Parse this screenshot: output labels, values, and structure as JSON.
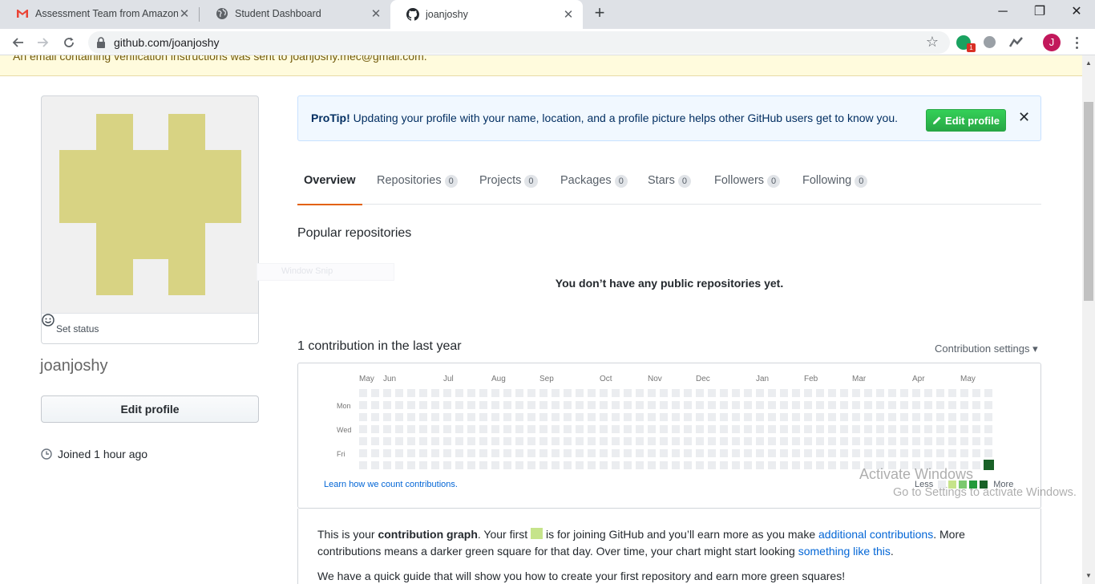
{
  "browser": {
    "tabs": [
      {
        "title": "Assessment Team from Amazon",
        "icon": "gmail-icon",
        "active": false
      },
      {
        "title": "Student Dashboard",
        "icon": "globe-icon",
        "active": false
      },
      {
        "title": "joanjoshy",
        "icon": "github-icon",
        "active": true
      }
    ],
    "tab_close": "✕",
    "new_tab": "+",
    "url": "github.com/joanjoshy",
    "extension_badge": "1",
    "profile_initial": "J",
    "window_controls": {
      "minimize": "─",
      "maximize": "❐",
      "close": "✕"
    }
  },
  "flash": {
    "message": "An email containing verification instructions was sent to joanjoshy.mec@gmail.com."
  },
  "sidebar": {
    "set_status": "Set status",
    "username": "joanjoshy",
    "edit_profile": "Edit profile",
    "joined": "Joined 1 hour ago"
  },
  "protip": {
    "label": "ProTip!",
    "text": " Updating your profile with your name, location, and a profile picture helps other GitHub users get to know you.",
    "button": "Edit profile",
    "close": "✕"
  },
  "nav_tabs": [
    {
      "label": "Overview",
      "count": null,
      "selected": true
    },
    {
      "label": "Repositories",
      "count": "0"
    },
    {
      "label": "Projects",
      "count": "0"
    },
    {
      "label": "Packages",
      "count": "0"
    },
    {
      "label": "Stars",
      "count": "0"
    },
    {
      "label": "Followers",
      "count": "0"
    },
    {
      "label": "Following",
      "count": "0"
    }
  ],
  "popular": {
    "title": "Popular repositories",
    "empty": "You don’t have any public repositories yet."
  },
  "ghost_tooltip": "Window Snip",
  "contributions": {
    "title": "1 contribution in the last year",
    "settings": "Contribution settings ▾",
    "months": [
      "May",
      "Jun",
      "Jul",
      "Aug",
      "Sep",
      "Oct",
      "Nov",
      "Dec",
      "Jan",
      "Feb",
      "Mar",
      "Apr",
      "May"
    ],
    "days": [
      "Mon",
      "Wed",
      "Fri"
    ],
    "learn_link": "Learn how we count contributions.",
    "legend_less": "Less",
    "legend_more": "More",
    "legend_colors": [
      "#ebedf0",
      "#c6e48b",
      "#7bc96f",
      "#239a3b",
      "#196127"
    ],
    "empty_color": "#ebedf0",
    "active_color": "#196127",
    "weeks": 53,
    "active_cell": {
      "week": 52,
      "day": 6,
      "count": 1
    }
  },
  "info": {
    "p1_a": "This is your ",
    "p1_b": "contribution graph",
    "p1_c": ". Your first ",
    "p1_d": " is for joining GitHub and you’ll earn more as you make ",
    "p1_link1": "additional contributions",
    "p1_e": ". More contributions means a darker green square for that day. Over time, your chart might start looking ",
    "p1_link2": "something like this",
    "p1_f": ".",
    "p2": "We have a quick guide that will show you how to create your first repository and earn more green squares!"
  },
  "watermark": {
    "line1": "Activate Windows",
    "line2": "Go to Settings to activate Windows."
  }
}
